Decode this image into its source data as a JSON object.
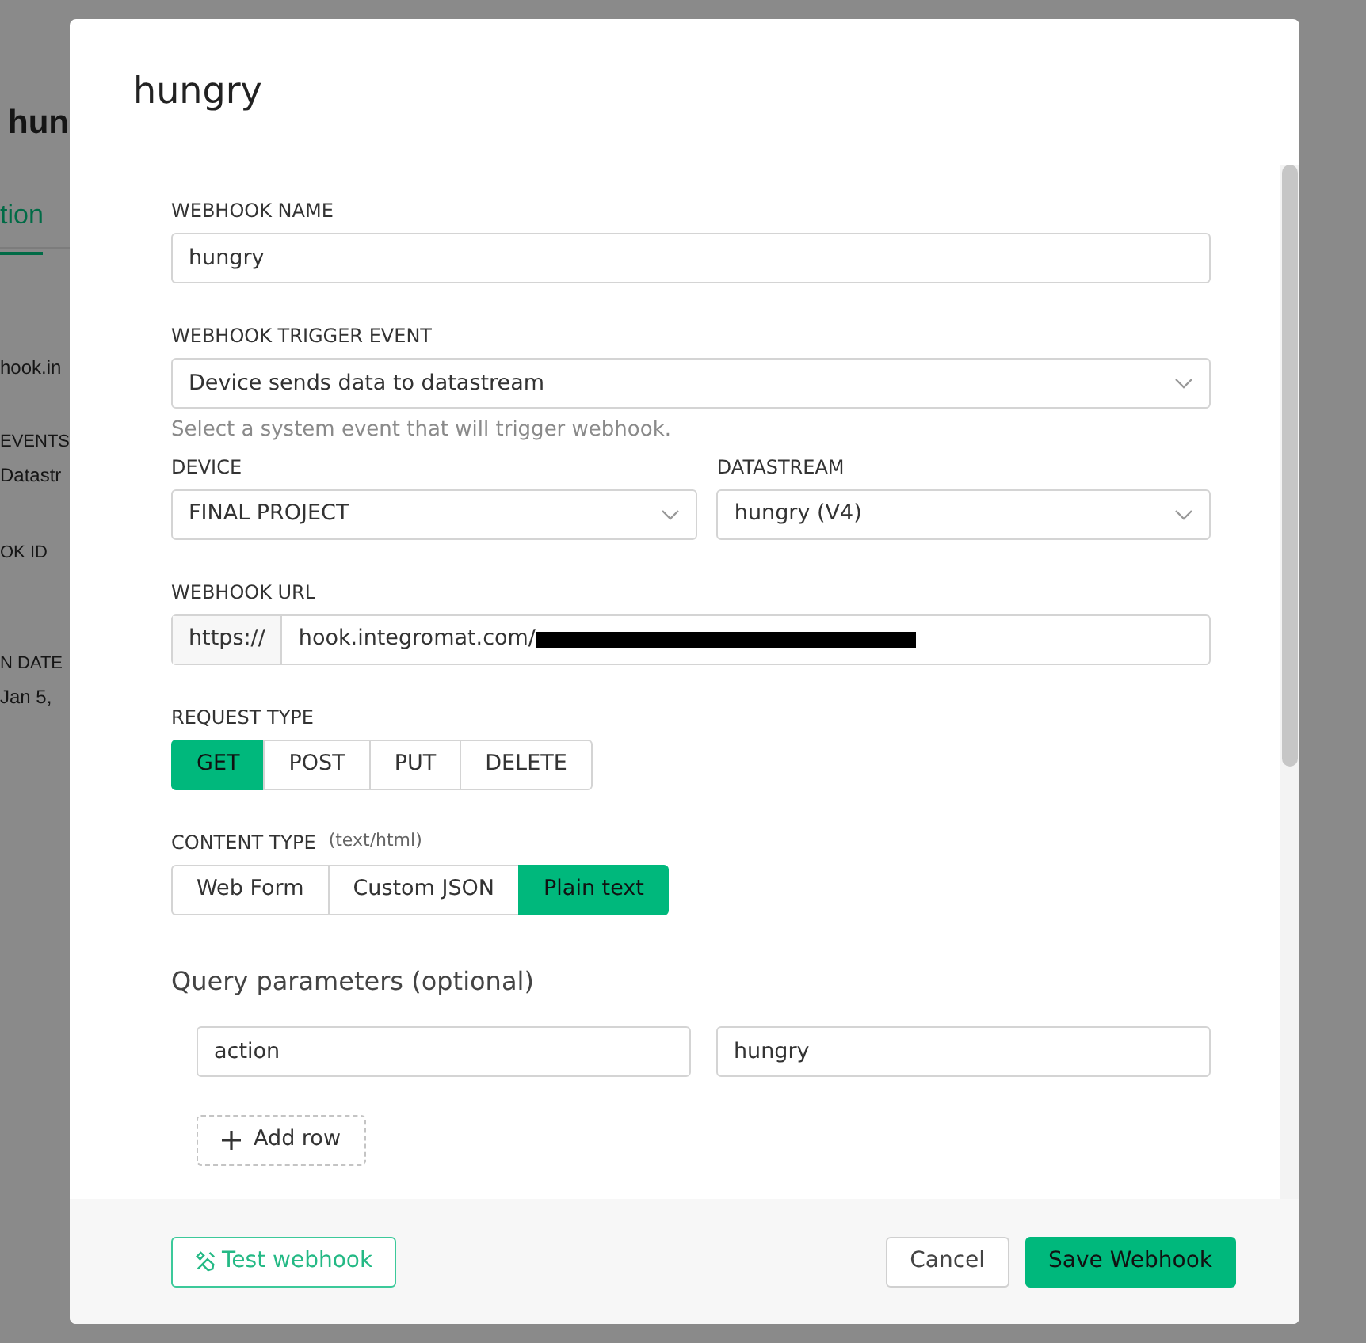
{
  "background_page": {
    "title": "hun",
    "tab": {
      "label": "tion",
      "selected": true
    },
    "texts": [
      "hook.in",
      "EVENTS",
      "Datastr",
      "OK ID",
      "N DATE",
      "Jan 5,"
    ]
  },
  "dialog": {
    "title": "hungry",
    "webhook_name": {
      "label": "WEBHOOK NAME",
      "value": "hungry"
    },
    "trigger_event": {
      "label": "WEBHOOK TRIGGER EVENT",
      "value": "Device sends data to datastream",
      "help": "Select a system event that will trigger webhook."
    },
    "device": {
      "label": "DEVICE",
      "value": "FINAL PROJECT"
    },
    "datastream": {
      "label": "DATASTREAM",
      "value": "hungry (V4)"
    },
    "webhook_url": {
      "label": "WEBHOOK URL",
      "prefix": "https://",
      "value": "hook.integromat.com/",
      "redacted": true
    },
    "request_type": {
      "label": "REQUEST TYPE",
      "options": [
        {
          "label": "GET",
          "selected": true
        },
        {
          "label": "POST",
          "selected": false
        },
        {
          "label": "PUT",
          "selected": false
        },
        {
          "label": "DELETE",
          "selected": false
        }
      ]
    },
    "content_type": {
      "label": "CONTENT TYPE",
      "hint": "(text/html)",
      "options": [
        {
          "label": "Web Form",
          "selected": false
        },
        {
          "label": "Custom JSON",
          "selected": false
        },
        {
          "label": "Plain text",
          "selected": true
        }
      ]
    },
    "query_parameters": {
      "title": "Query parameters (optional)",
      "rows": [
        {
          "key": "action",
          "value": "hungry"
        }
      ],
      "add_row": "Add row"
    },
    "footer": {
      "test": "Test webhook",
      "cancel": "Cancel",
      "save": "Save Webhook"
    }
  }
}
